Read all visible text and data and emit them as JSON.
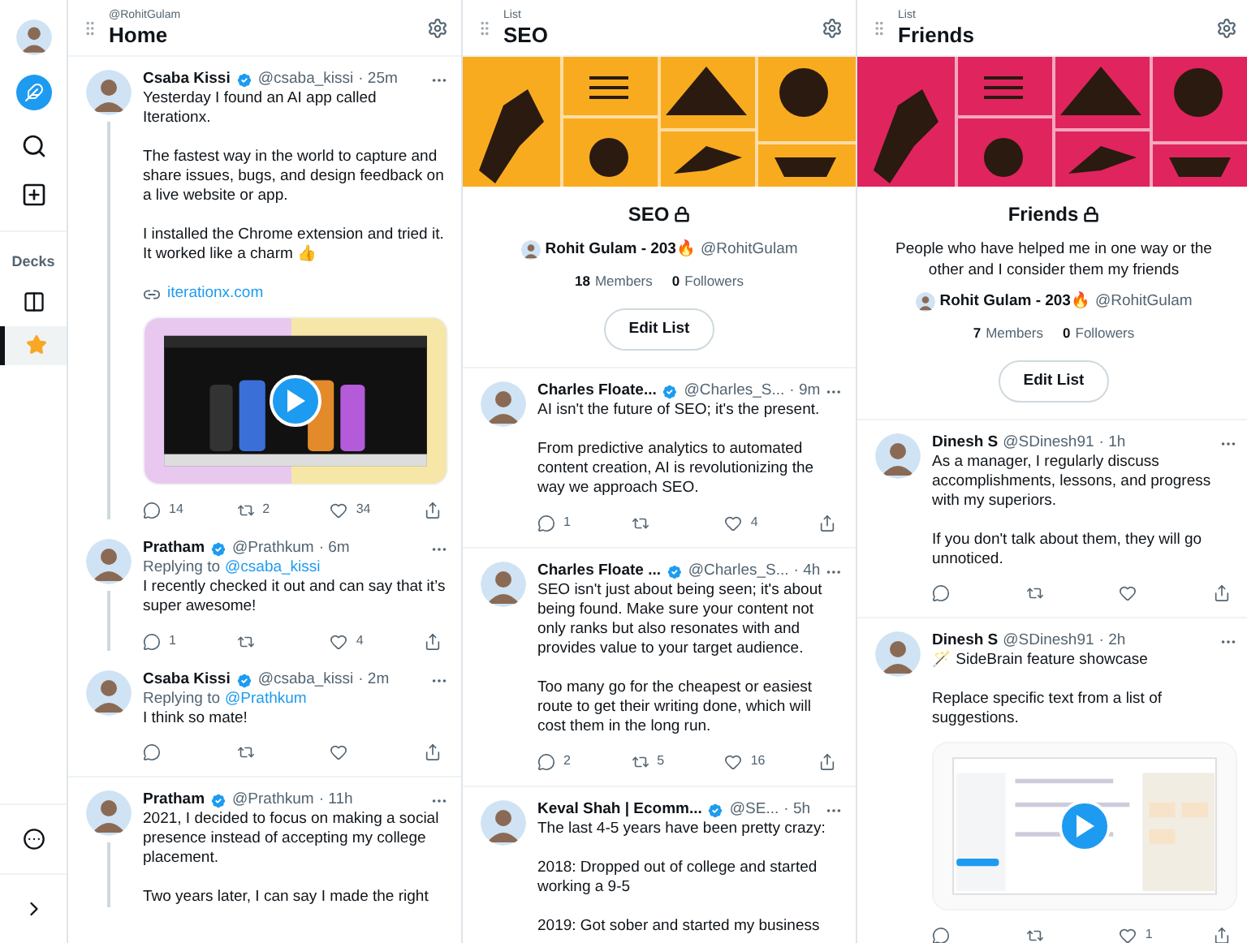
{
  "sidebar": {
    "section_label": "Decks",
    "decks": [
      {
        "selected": true
      }
    ]
  },
  "columns": [
    {
      "label": "@RohitGulam",
      "title": "Home",
      "tweets": [
        {
          "name": "Csaba Kissi",
          "verified": true,
          "handle": "@csaba_kissi",
          "time": "· 25m",
          "threaded": true,
          "text": [
            "Yesterday I found an AI app called Iterationx.",
            "The fastest way in the world to capture and share issues, bugs, and design feedback on a live website or app.",
            "I installed the Chrome extension and tried it. It worked like a charm 👍"
          ],
          "link": "iterationx.com",
          "media": {
            "kind": "video"
          },
          "action_bar": true,
          "actions": {
            "reply": "14",
            "retweet": "2",
            "like": "34"
          }
        },
        {
          "name": "Pratham",
          "verified": true,
          "handle": "@Prathkum",
          "time": "· 6m",
          "threaded": true,
          "replying_label": "Replying to",
          "replying_to": "@csaba_kissi",
          "text": [
            "I recently checked it out and can say that it’s super awesome!"
          ],
          "action_bar": true,
          "actions": {
            "reply": "1",
            "like": "4"
          }
        },
        {
          "name": "Csaba Kissi",
          "verified": true,
          "handle": "@csaba_kissi",
          "time": "· 2m",
          "threaded": false,
          "replying_label": "Replying to",
          "replying_to": "@Prathkum",
          "text": [
            "I think so mate!"
          ],
          "action_bar": true
        },
        {
          "name": "Pratham",
          "verified": true,
          "handle": "@Prathkum",
          "time": "· 11h",
          "threaded": true,
          "text": [
            "2021, I decided to focus on making a social presence instead of accepting my college placement.",
            "Two years later, I can say I made the right"
          ],
          "action_bar": false
        }
      ]
    },
    {
      "label": "List",
      "title": "SEO",
      "list": {
        "name": "SEO",
        "owner": "Rohit Gulam - 203🔥",
        "owner_handle": "@RohitGulam",
        "members": "18",
        "members_label": "Members",
        "followers": "0",
        "followers_label": "Followers",
        "button": "Edit List"
      },
      "tweets": [
        {
          "name": "Charles Floate...",
          "verified": true,
          "handle": "@Charles_S...",
          "time": "· 9m",
          "threaded": false,
          "text": [
            "AI isn't the future of SEO; it's the present.",
            "From predictive analytics to automated content creation, AI is revolutionizing the way we approach SEO."
          ],
          "action_bar": true,
          "actions": {
            "reply": "1",
            "like": "4"
          }
        },
        {
          "name": "Charles Floate ...",
          "verified": true,
          "handle": "@Charles_S...",
          "time": "· 4h",
          "threaded": false,
          "text": [
            "SEO isn't just about being seen; it's about being found. Make sure your content not only ranks but also resonates with and provides value to your target audience.",
            "Too many go for the cheapest or easiest route to get their writing done, which will cost them in the long run."
          ],
          "action_bar": true,
          "actions": {
            "reply": "2",
            "retweet": "5",
            "like": "16"
          }
        },
        {
          "name": "Keval Shah | Ecomm...",
          "verified": true,
          "handle": "@SE...",
          "time": "· 5h",
          "threaded": false,
          "text": [
            "The last 4-5 years have been pretty crazy:",
            "2018: Dropped out of college and started working a 9-5",
            "2019: Got sober and started my business"
          ],
          "action_bar": false
        }
      ]
    },
    {
      "label": "List",
      "title": "Friends",
      "list": {
        "name": "Friends",
        "description": "People who have helped me in one way or the other and I consider them my friends",
        "owner": "Rohit Gulam - 203🔥",
        "owner_handle": "@RohitGulam",
        "members": "7",
        "members_label": "Members",
        "followers": "0",
        "followers_label": "Followers",
        "button": "Edit List"
      },
      "tweets": [
        {
          "name": "Dinesh S",
          "verified": false,
          "handle": "@SDinesh91",
          "time": "· 1h",
          "threaded": false,
          "text": [
            "As a manager, I regularly discuss accomplishments, lessons, and progress with my superiors.",
            "If you don't talk about them, they will go unnoticed."
          ],
          "action_bar": true
        },
        {
          "name": "Dinesh S",
          "verified": false,
          "handle": "@SDinesh91",
          "time": "· 2h",
          "threaded": false,
          "text": [
            "🪄 SideBrain feature showcase",
            "Replace specific text from a list of suggestions."
          ],
          "media": {
            "kind": "screen"
          },
          "action_bar": true,
          "actions": {
            "like": "1"
          }
        }
      ]
    }
  ]
}
